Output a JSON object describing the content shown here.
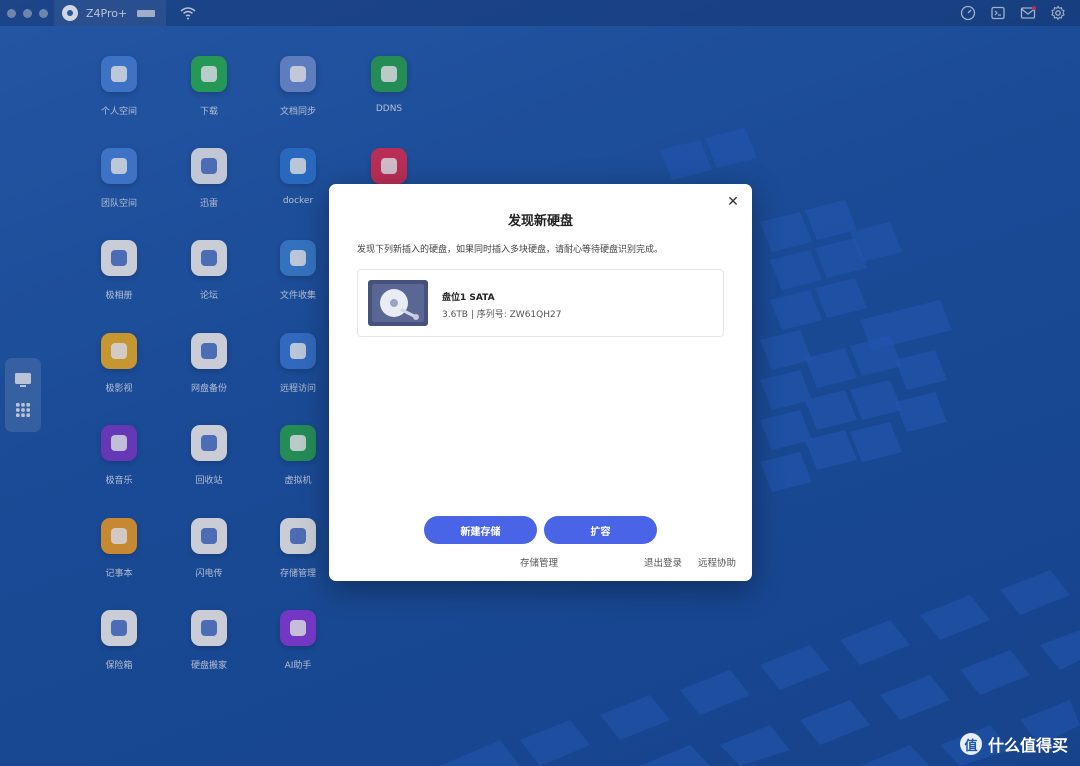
{
  "topbar": {
    "device_name": "Z4Pro+",
    "icons": [
      "window-control-dots",
      "user-avatar",
      "wifi-icon",
      "speed-icon",
      "terminal-icon",
      "mail-icon",
      "settings-icon"
    ]
  },
  "desktop": {
    "apps": [
      {
        "label": "个人空间",
        "icon": "folder-icon",
        "color": "#4a86e0"
      },
      {
        "label": "下载",
        "icon": "download-icon",
        "color": "#2bb45a"
      },
      {
        "label": "文档同步",
        "icon": "sync-icon",
        "color": "#6f93d8"
      },
      {
        "label": "DDNS",
        "icon": "ddns-icon",
        "color": "#2ba55a"
      },
      {
        "label": "团队空间",
        "icon": "team-folder-icon",
        "color": "#4a86e0"
      },
      {
        "label": "迅雷",
        "icon": "thunder-icon",
        "color": "#e9edf5"
      },
      {
        "label": "docker",
        "icon": "docker-icon",
        "color": "#2f79d8"
      },
      {
        "label": "",
        "icon": "cube-app-icon",
        "color": "#e0335a"
      },
      {
        "label": "极相册",
        "icon": "photos-icon",
        "color": "#f4f4f4"
      },
      {
        "label": "论坛",
        "icon": "forum-icon",
        "color": "#f4f4f4"
      },
      {
        "label": "文件收集",
        "icon": "file-collect-icon",
        "color": "#3f86d8"
      },
      {
        "label": "极影视",
        "icon": "video-icon",
        "color": "#f0b12d"
      },
      {
        "label": "网盘备份",
        "icon": "cloud-backup-icon",
        "color": "#f4f4f4"
      },
      {
        "label": "远程访问",
        "icon": "remote-access-icon",
        "color": "#3a7ad8"
      },
      {
        "label": "极音乐",
        "icon": "music-icon",
        "color": "#7a3ed0"
      },
      {
        "label": "回收站",
        "icon": "trash-icon",
        "color": "#f4f4f4"
      },
      {
        "label": "虚拟机",
        "icon": "vm-icon",
        "color": "#2ba55a"
      },
      {
        "label": "记事本",
        "icon": "notepad-icon",
        "color": "#f0a22d"
      },
      {
        "label": "闪电传",
        "icon": "flash-transfer-icon",
        "color": "#f4f4f4"
      },
      {
        "label": "存储管理",
        "icon": "storage-icon",
        "color": "#f4f4f4"
      },
      {
        "label": "保险箱",
        "icon": "safe-icon",
        "color": "#f4f4f4"
      },
      {
        "label": "硬盘搬家",
        "icon": "disk-move-icon",
        "color": "#f4f4f4"
      },
      {
        "label": "AI助手",
        "icon": "ai-assistant-icon",
        "color": "#8a3ee0"
      }
    ]
  },
  "dock": {
    "icons": [
      "monitor-icon",
      "grid-icon"
    ]
  },
  "dialog": {
    "title": "发现新硬盘",
    "description": "发现下列新插入的硬盘，如果同时插入多块硬盘，请耐心等待硬盘识别完成。",
    "disk": {
      "name": "盘位1 SATA",
      "meta": "3.6TB | 序列号: ZW61QH27"
    },
    "buttons": {
      "new_storage": "新建存储",
      "expand": "扩容"
    },
    "links": {
      "storage_manage": "存储管理",
      "logout": "退出登录",
      "remote_help": "远程协助"
    }
  },
  "watermark": {
    "logo_char": "值",
    "text": "什么值得买"
  }
}
